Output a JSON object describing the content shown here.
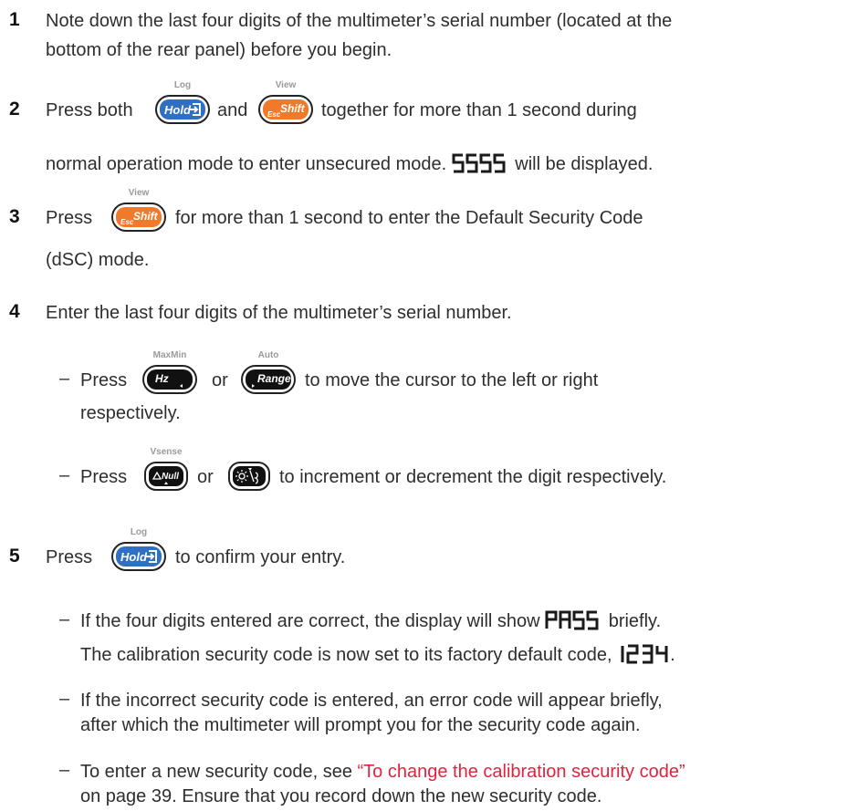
{
  "steps": {
    "s1": {
      "num": "1",
      "l1": "Note down the last four digits of the multimeter’s serial number (located at the",
      "l2": "bottom of the rear panel) before you begin."
    },
    "s2": {
      "num": "2",
      "a": "Press both",
      "b": "and",
      "c": "together for more than 1 second during",
      "d": "normal operation mode to enter unsecured mode.",
      "e": "will be displayed."
    },
    "s3": {
      "num": "3",
      "a": "Press",
      "b": "for more than 1 second to enter the Default Security Code",
      "l2": "(dSC) mode."
    },
    "s4": {
      "num": "4",
      "l1": "Enter the last four digits of the multimeter’s serial number.",
      "b1a": "Press",
      "b1b": "or",
      "b1c": "to move the cursor to the left or right",
      "b1d": "respectively.",
      "b2a": "Press",
      "b2b": "or",
      "b2c": "to increment or decrement the digit respectively."
    },
    "s5": {
      "num": "5",
      "a": "Press",
      "b": "to confirm your entry.",
      "b1a": "If the four digits entered are correct, the display will show",
      "b1b": "briefly.",
      "b1c": "The calibration security code is now set to its factory default code,",
      "b1d": ".",
      "b2a": "If the incorrect security code is entered, an error code will appear briefly,",
      "b2b": "after which the multimeter will prompt you for the security code again.",
      "b3a": "To enter a new security code, see",
      "b3link": "“To change the calibration security code”",
      "b3b": "on page 39. Ensure that you record down the new security code."
    }
  },
  "displays": {
    "unsecured": "5555",
    "pass": "PASS",
    "default_code": "1234"
  },
  "keys": {
    "hold": {
      "label": "Hold",
      "top": "Log",
      "color": "#2f6fc4"
    },
    "shift": {
      "label": "Shift",
      "sub": "Esc",
      "top": "View",
      "color": "#f07a2a"
    },
    "hz": {
      "label": "Hz",
      "top": "MaxMin",
      "color": "#111111"
    },
    "range": {
      "label": "Range",
      "top": "Auto",
      "color": "#111111"
    },
    "null": {
      "label": "Null",
      "top": "Vsense",
      "color": "#111111"
    },
    "backlight": {
      "icon": "backlight-icon",
      "color": "#111111"
    }
  },
  "dash": "–"
}
